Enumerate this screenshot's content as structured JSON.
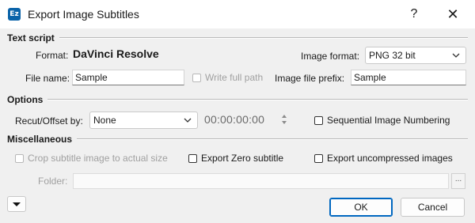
{
  "window": {
    "title": "Export Image Subtitles",
    "app_icon_text": "Ez",
    "help_label": "?",
    "close_label": "✕"
  },
  "text_script": {
    "header": "Text script",
    "format_label": "Format:",
    "format_value": "DaVinci Resolve",
    "image_format_label": "Image format:",
    "image_format_value": "PNG 32 bit",
    "file_name_label": "File name:",
    "file_name_value": "Sample",
    "write_full_path_label": "Write full path",
    "write_full_path_checked": false,
    "image_prefix_label": "Image file prefix:",
    "image_prefix_value": "Sample"
  },
  "options": {
    "header": "Options",
    "recut_label": "Recut/Offset by:",
    "recut_value": "None",
    "timecode": "00:00:00:00",
    "sequential_label": "Sequential Image Numbering",
    "sequential_checked": false
  },
  "misc": {
    "header": "Miscellaneous",
    "crop_label": "Crop subtitle image to actual size",
    "crop_checked": false,
    "export_zero_label": "Export Zero subtitle",
    "export_zero_checked": false,
    "export_uncompressed_label": "Export uncompressed images",
    "export_uncompressed_checked": false,
    "folder_label": "Folder:",
    "folder_value": "",
    "browse_label": "..."
  },
  "buttons": {
    "ok_label": "OK",
    "cancel_label": "Cancel"
  },
  "colors": {
    "accent": "#0067c0",
    "app_icon": "#0a63a9"
  }
}
